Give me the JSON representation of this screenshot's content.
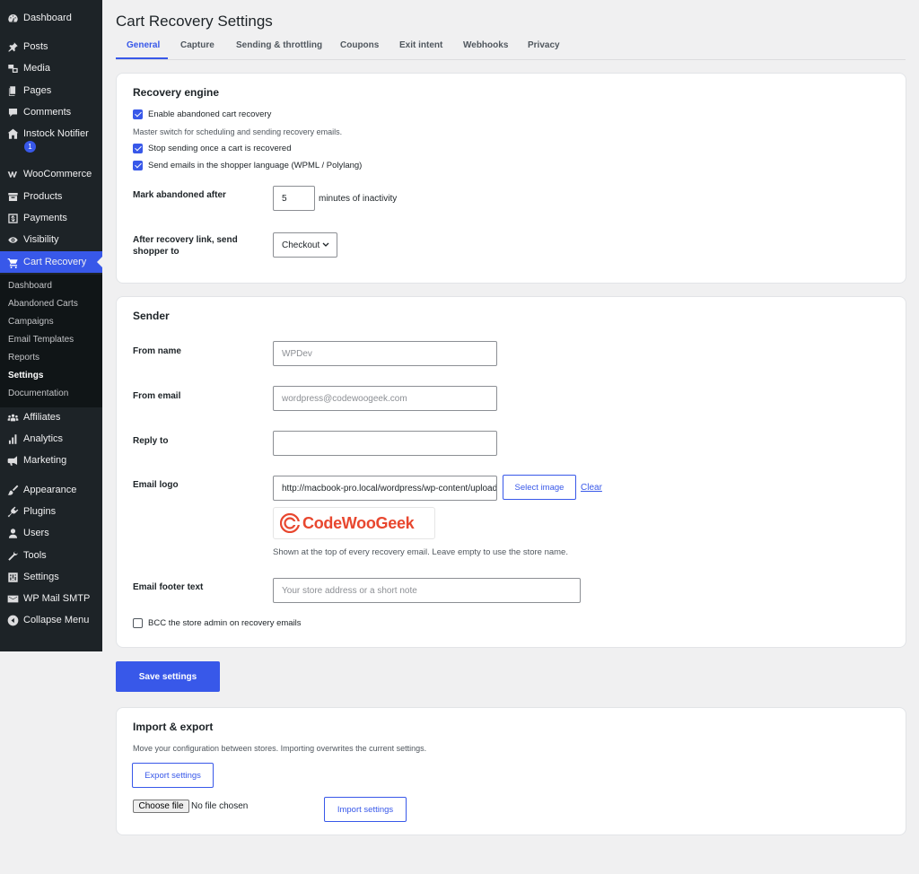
{
  "sidebar": {
    "items": [
      {
        "label": "Dashboard",
        "icon": "dashboard-icon"
      },
      {
        "label": "Posts",
        "icon": "pin-icon"
      },
      {
        "label": "Media",
        "icon": "media-icon"
      },
      {
        "label": "Pages",
        "icon": "pages-icon"
      },
      {
        "label": "Comments",
        "icon": "comment-icon"
      },
      {
        "label": "Instock Notifier",
        "icon": "store-icon"
      },
      {
        "label": "WooCommerce",
        "icon": "woo-icon"
      },
      {
        "label": "Products",
        "icon": "archive-icon"
      },
      {
        "label": "Payments",
        "icon": "dollar-icon"
      },
      {
        "label": "Visibility",
        "icon": "eye-icon"
      },
      {
        "label": "Cart Recovery",
        "icon": "cart-icon"
      },
      {
        "label": "Affiliates",
        "icon": "groups-icon"
      },
      {
        "label": "Analytics",
        "icon": "chart-icon"
      },
      {
        "label": "Marketing",
        "icon": "megaphone-icon"
      },
      {
        "label": "Appearance",
        "icon": "brush-icon"
      },
      {
        "label": "Plugins",
        "icon": "plugin-icon"
      },
      {
        "label": "Users",
        "icon": "user-icon"
      },
      {
        "label": "Tools",
        "icon": "wrench-icon"
      },
      {
        "label": "Settings",
        "icon": "settings-icon"
      },
      {
        "label": "WP Mail SMTP",
        "icon": "mail-icon"
      },
      {
        "label": "Collapse Menu",
        "icon": "collapse-icon"
      }
    ],
    "badge": "1",
    "submenu": [
      "Dashboard",
      "Abandoned Carts",
      "Campaigns",
      "Email Templates",
      "Reports",
      "Settings",
      "Documentation"
    ],
    "active_item": "Cart Recovery",
    "current_subitem": "Settings"
  },
  "page": {
    "title": "Cart Recovery Settings",
    "tabs": [
      "General",
      "Capture",
      "Sending & throttling",
      "Coupons",
      "Exit intent",
      "Webhooks",
      "Privacy"
    ],
    "active_tab": "General"
  },
  "recovery_engine": {
    "title": "Recovery engine",
    "enable_label": "Enable abandoned cart recovery",
    "enable_help": "Master switch for scheduling and sending recovery emails.",
    "stop_label": "Stop sending once a cart is recovered",
    "language_label": "Send emails in the shopper language (WPML / Polylang)",
    "mark_label": "Mark abandoned after",
    "mark_value": "5",
    "mark_suffix": "minutes of inactivity",
    "redirect_label": "After recovery link, send shopper to",
    "redirect_value": "Checkout"
  },
  "sender": {
    "title": "Sender",
    "from_name_label": "From name",
    "from_name_placeholder": "WPDev",
    "from_email_label": "From email",
    "from_email_placeholder": "wordpress@codewoogeek.com",
    "reply_to_label": "Reply to",
    "reply_to_value": "",
    "logo_label": "Email logo",
    "logo_value": "http://macbook-pro.local/wordpress/wp-content/uploads/codewoogeek-logo.png",
    "select_image_label": "Select image",
    "clear_label": "Clear",
    "logo_text": "CodeWooGeek",
    "logo_help": "Shown at the top of every recovery email. Leave empty to use the store name.",
    "footer_label": "Email footer text",
    "footer_placeholder": "Your store address or a short note",
    "bcc_label": "BCC the store admin on recovery emails"
  },
  "save_label": "Save settings",
  "import_export": {
    "title": "Import & export",
    "help": "Move your configuration between stores. Importing overwrites the current settings.",
    "export_label": "Export settings",
    "choose_file_label": "Choose file",
    "no_file_text": "No file chosen",
    "import_label": "Import settings"
  },
  "colors": {
    "accent": "#3858e9",
    "sidebar_bg": "#1d2327",
    "logo_red": "#e8472f"
  }
}
